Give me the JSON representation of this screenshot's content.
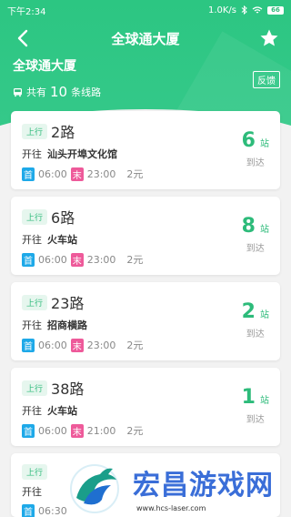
{
  "status_bar": {
    "time": "下午2:34",
    "speed": "1.0K/s",
    "battery": "66"
  },
  "nav": {
    "title": "全球通大厦"
  },
  "station": {
    "name": "全球通大厦",
    "lines_prefix": "共有",
    "lines_count": "10",
    "lines_suffix": "条线路",
    "feedback_label": "反馈"
  },
  "routes": [
    {
      "direction": "上行",
      "name": "2路",
      "to_label": "开往",
      "destination": "汕头开埠文化馆",
      "first_label": "首",
      "first_time": "06:00",
      "last_label": "末",
      "last_time": "23:00",
      "fare": "2元",
      "stops": "6",
      "stops_unit": "站",
      "arrive_label": "到达"
    },
    {
      "direction": "上行",
      "name": "6路",
      "to_label": "开往",
      "destination": "火车站",
      "first_label": "首",
      "first_time": "06:00",
      "last_label": "末",
      "last_time": "23:00",
      "fare": "2元",
      "stops": "8",
      "stops_unit": "站",
      "arrive_label": "到达"
    },
    {
      "direction": "上行",
      "name": "23路",
      "to_label": "开往",
      "destination": "招商横路",
      "first_label": "首",
      "first_time": "06:00",
      "last_label": "末",
      "last_time": "23:00",
      "fare": "2元",
      "stops": "2",
      "stops_unit": "站",
      "arrive_label": "到达"
    },
    {
      "direction": "上行",
      "name": "38路",
      "to_label": "开往",
      "destination": "火车站",
      "first_label": "首",
      "first_time": "06:00",
      "last_label": "末",
      "last_time": "21:00",
      "fare": "2元",
      "stops": "1",
      "stops_unit": "站",
      "arrive_label": "到达"
    },
    {
      "direction": "上行",
      "to_label": "开往",
      "first_label": "首",
      "first_time": "06:30"
    }
  ],
  "watermark": {
    "title": "宏昌游戏网",
    "url": "www.hcs-laser.com"
  },
  "colors": {
    "brand_green": "#2dbb7a",
    "first_tag": "#1ea9e8",
    "last_tag": "#ee5a9a",
    "watermark_blue": "#3a6ed8"
  },
  "icons": [
    "back-arrow-icon",
    "star-icon",
    "bus-icon",
    "bluetooth-icon",
    "wifi-icon",
    "battery-icon"
  ]
}
